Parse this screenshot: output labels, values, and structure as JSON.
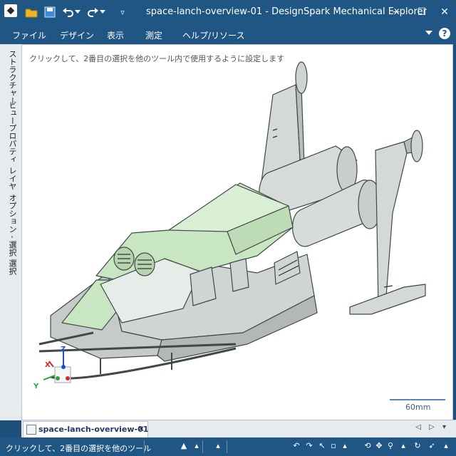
{
  "window": {
    "title": "space-lanch-overview-01 - DesignSpark Mechanical Explorer",
    "controls": {
      "minimize": "−",
      "maximize": "☐",
      "close": "✕"
    }
  },
  "quick_access": {
    "redo_extra": "▿"
  },
  "menu": {
    "items": [
      "ファイル",
      "デザイン",
      "表示",
      "測定",
      "ヘルプ/リソース"
    ],
    "help": "?"
  },
  "side_tabs": [
    "ストラクチャー",
    "ビュー",
    "プロパティ",
    "レイヤ",
    "オプション - 選択",
    "選択"
  ],
  "viewport": {
    "hint": "クリックして、2番目の選択を他のツール内で使用するように設定します",
    "scale_label": "60mm",
    "axes": {
      "z": "Z",
      "x": "X",
      "y": "Y"
    }
  },
  "document_tabs": [
    {
      "name": "space-lanch-overview-01",
      "close": "✕"
    }
  ],
  "doc_nav": "◁ ▷ ▾",
  "statusbar": {
    "text": "クリックして、2番目の選択を他のツール"
  },
  "colors": {
    "chrome": "#1f5683",
    "selected_body": "#c8e6c2",
    "model_gray": "#d4d8d6",
    "model_edge": "#404848"
  },
  "icons": [
    "app-logo-icon",
    "open-folder-icon",
    "save-icon",
    "undo-icon",
    "redo-icon",
    "select-icon",
    "pan-icon",
    "zoom-icon",
    "rotate-icon",
    "help-icon"
  ]
}
